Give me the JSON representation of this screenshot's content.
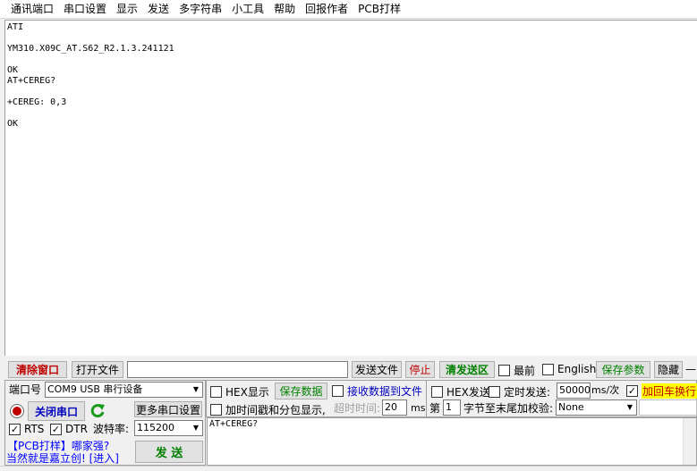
{
  "menu": [
    "通讯端口",
    "串口设置",
    "显示",
    "发送",
    "多字符串",
    "小工具",
    "帮助",
    "回报作者",
    "PCB打样"
  ],
  "receive_lines": [
    "ATI",
    "",
    "YM310.X09C_AT.S62_R2.1.3.241121",
    "",
    "OK",
    "AT+CEREG?",
    "",
    "+CEREG: 0,3",
    "",
    "OK"
  ],
  "toolbar": {
    "clear_window": "清除窗口",
    "open_file": "打开文件",
    "file_path": "",
    "send_file": "发送文件",
    "stop": "停止",
    "clear_send": "清发送区",
    "topmost": "最前",
    "english": "English",
    "save_params": "保存参数",
    "hide": "隐藏",
    "dash": "—"
  },
  "port": {
    "port_label": "端口号",
    "port_value": "COM9 USB 串行设备",
    "close_port": "关闭串口",
    "more_settings": "更多串口设置",
    "rts": "RTS",
    "dtr": "DTR",
    "baud_label": "波特率:",
    "baud_value": "115200",
    "ad_line1": "【PCB打样】哪家强?",
    "ad_line2": "当然就是嘉立创! [进入]"
  },
  "options": {
    "hex_display": "HEX显示",
    "save_data": "保存数据",
    "recv_to_file": "接收数据到文件",
    "hex_send": "HEX发送",
    "timed_send": "定时发送:",
    "interval": "50000",
    "interval_unit": "ms/次",
    "add_crlf": "加回车换行",
    "timestamp": "加时间戳和分包显示,",
    "timeout_label": "超时时间:",
    "timeout_value": "20",
    "timeout_unit": "ms",
    "di": "第",
    "byte_index": "1",
    "checksum_label": "字节至末尾加校验:",
    "checksum_value": "None",
    "send_button": "发  送",
    "send_text": "AT+CEREG?"
  },
  "colors": {
    "red_text": "#c00000",
    "green_text": "#008000",
    "crlf_highlight": "#ffff00"
  }
}
